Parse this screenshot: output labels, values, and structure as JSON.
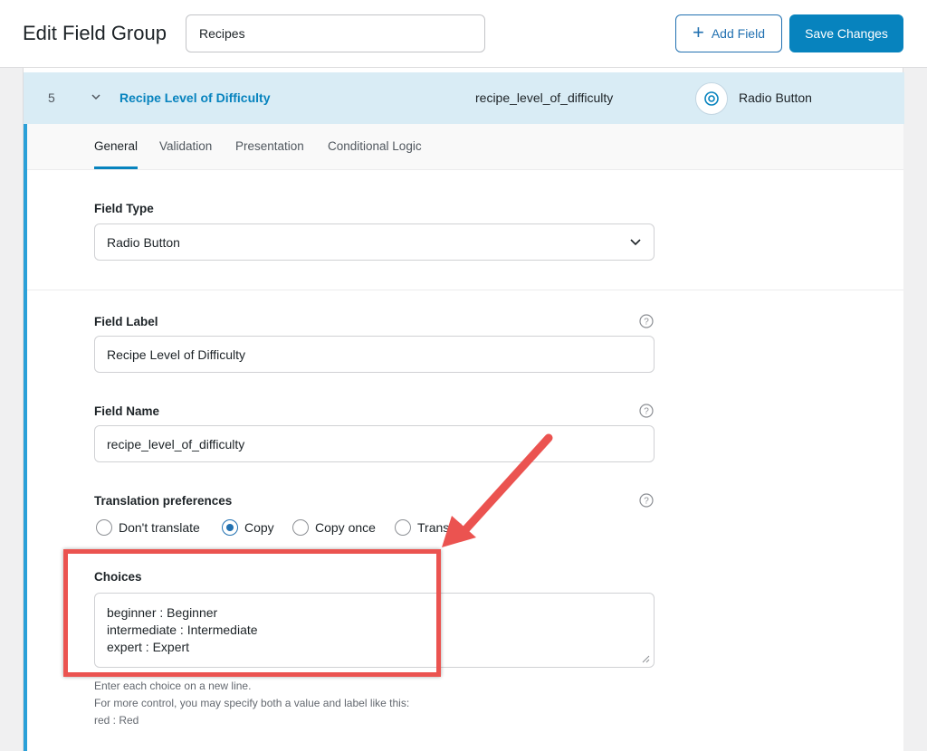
{
  "header": {
    "title": "Edit Field Group",
    "group_name": "Recipes",
    "add_field_label": "Add Field",
    "save_label": "Save Changes"
  },
  "field": {
    "order": "5",
    "label": "Recipe Level of Difficulty",
    "key": "recipe_level_of_difficulty",
    "type": "Radio Button"
  },
  "tabs": [
    {
      "label": "General",
      "active": true
    },
    {
      "label": "Validation"
    },
    {
      "label": "Presentation"
    },
    {
      "label": "Conditional Logic"
    }
  ],
  "settings": {
    "field_type": {
      "label": "Field Type",
      "value": "Radio Button"
    },
    "field_label": {
      "label": "Field Label",
      "value": "Recipe Level of Difficulty"
    },
    "field_name": {
      "label": "Field Name",
      "value": "recipe_level_of_difficulty"
    },
    "translation": {
      "label": "Translation preferences",
      "options": [
        "Don't translate",
        "Copy",
        "Copy once",
        "Translate"
      ],
      "selected": "Copy"
    },
    "choices": {
      "label": "Choices",
      "lines": [
        "beginner : Beginner",
        "intermediate : Intermediate",
        "expert : Expert"
      ],
      "hint": [
        "Enter each choice on a new line.",
        "For more control, you may specify both a value and label like this:",
        "red : Red"
      ]
    }
  },
  "colors": {
    "accent": "#0783be",
    "row_highlight": "#d9ecf5",
    "annotation": "#eb5350"
  }
}
